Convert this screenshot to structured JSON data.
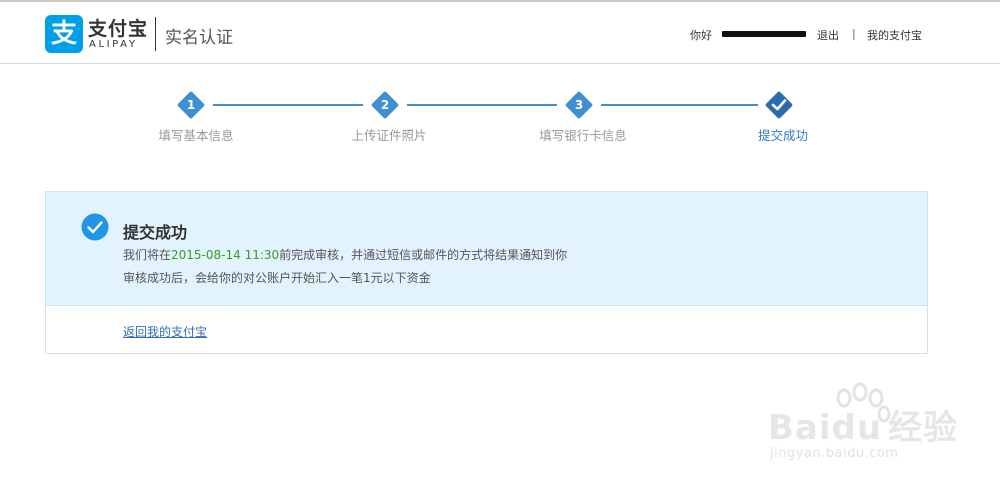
{
  "header": {
    "logo_glyph": "支",
    "logo_cn": "支付宝",
    "logo_en": "ALIPAY",
    "title": "实名认证",
    "greeting": "你好",
    "logout": "退出",
    "separator": "|",
    "my_alipay": "我的支付宝",
    "brand_color": "#00a0e9"
  },
  "steps": [
    {
      "number": "1",
      "label": "填写基本信息",
      "state": "done"
    },
    {
      "number": "2",
      "label": "上传证件照片",
      "state": "done"
    },
    {
      "number": "3",
      "label": "填写银行卡信息",
      "state": "done"
    },
    {
      "number": "",
      "label": "提交成功",
      "state": "current",
      "icon": "check-icon"
    }
  ],
  "result": {
    "title": "提交成功",
    "line1_prefix": "我们将在",
    "line1_date": "2015-08-14 11:30",
    "line1_suffix": "前完成审核，并通过短信或邮件的方式将结果通知到你",
    "line2": "审核成功后，会给你的对公账户开始汇入一笔1元以下资金",
    "return_link": "返回我的支付宝",
    "accent_color": "#2d7dc2",
    "date_color": "#3a9d23"
  },
  "watermark": {
    "brand": "Bai",
    "brand2": "du",
    "cn": "经验",
    "url": "jingyan.baidu.com"
  }
}
